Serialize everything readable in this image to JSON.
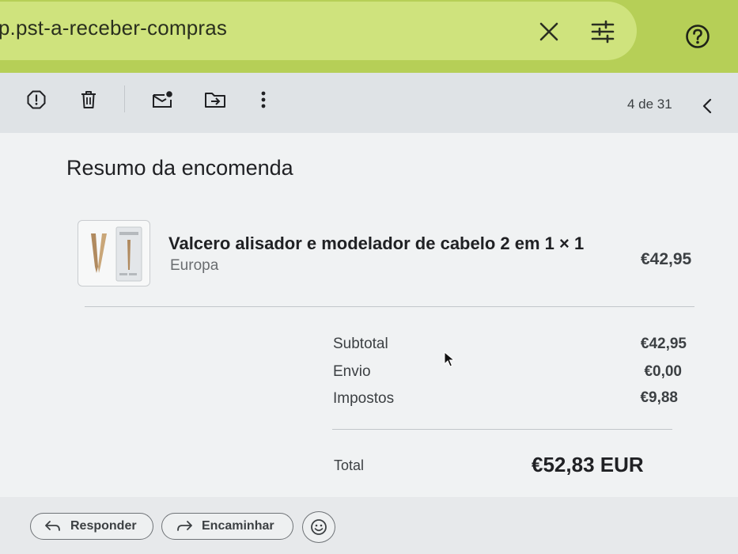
{
  "search": {
    "query": "kup.pst-a-receber-compras",
    "icons": [
      "close-icon",
      "tune-icon",
      "help-icon"
    ]
  },
  "toolbar": {
    "icons": [
      "report-spam-icon",
      "delete-icon",
      "mark-unread-icon",
      "move-to-icon",
      "more-icon"
    ],
    "pager": "4 de 31",
    "prev_icon": "chevron-left-icon"
  },
  "order": {
    "heading": "Resumo da encomenda",
    "item": {
      "name": "Valcero alisador e modelador de cabelo 2 em 1 × 1",
      "variant": "Europa",
      "price": "€42,95"
    },
    "summary": [
      {
        "label": "Subtotal",
        "value": "€42,95"
      },
      {
        "label": "Envio",
        "value": "€0,00"
      },
      {
        "label": "Impostos",
        "value": "€9,88"
      }
    ],
    "total_label": "Total",
    "total_value": "€52,83 EUR"
  },
  "actions": {
    "reply_label": "Responder",
    "forward_label": "Encaminhar",
    "emoji_icon": "emoji-icon"
  },
  "colors": {
    "search_bar": "#cfe37d",
    "top_band": "#b6cf57"
  }
}
